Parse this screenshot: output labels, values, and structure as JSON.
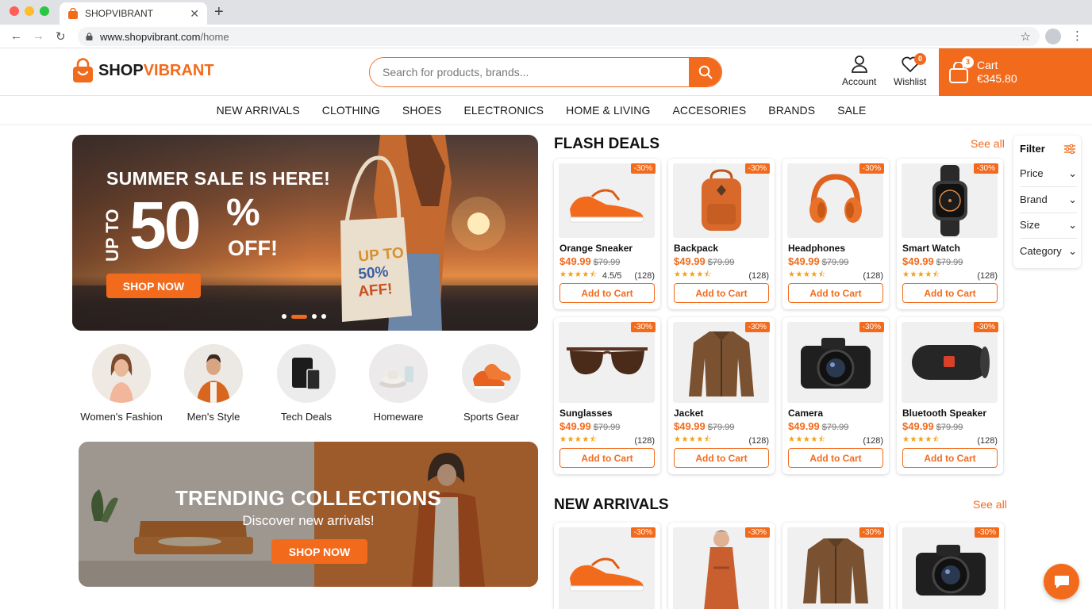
{
  "browser": {
    "tab_title": "SHOPVIBRANT",
    "url_host": "www.shopvibrant.com",
    "url_path": "/home"
  },
  "header": {
    "logo_part1": "SHOP",
    "logo_part2": "VIBRANT",
    "search_placeholder": "Search for products, brands...",
    "account_label": "Account",
    "wishlist_label": "Wishlist",
    "wishlist_count": "0",
    "cart_label": "Cart",
    "cart_total": "€345.80",
    "cart_count": "3"
  },
  "nav": [
    "NEW ARRIVALS",
    "CLOTHING",
    "SHOES",
    "ELECTRONICS",
    "HOME & LIVING",
    "ACCESORIES",
    "BRANDS",
    "SALE"
  ],
  "hero": {
    "headline": "SUMMER SALE IS HERE!",
    "upto": "UP TO",
    "big": "50",
    "pct": "%",
    "off": "OFF!",
    "button": "SHOP NOW",
    "bag_text": "UP TO 50% AFF!",
    "slides": 4,
    "active_slide": 2
  },
  "categories": [
    {
      "label": "Women's Fashion",
      "icon": "woman-icon"
    },
    {
      "label": "Men's Style",
      "icon": "man-icon"
    },
    {
      "label": "Tech Deals",
      "icon": "tablet-icon"
    },
    {
      "label": "Homeware",
      "icon": "dishes-icon"
    },
    {
      "label": "Sports Gear",
      "icon": "sneakers-icon"
    }
  ],
  "trending": {
    "title": "TRENDING COLLECTIONS",
    "subtitle": "Discover new arrivals!",
    "button": "SHOP NOW"
  },
  "flash_deals": {
    "title": "FLASH DEALS",
    "see_all": "See all",
    "products": [
      {
        "name": "Orange Sneaker",
        "price": "$49.99",
        "old_price": "$79.99",
        "discount": "-30%",
        "rating_text": "4.5/5",
        "reviews": "(128)",
        "stars": 4.5,
        "button": "Add to Cart",
        "icon": "sneaker"
      },
      {
        "name": "Backpack",
        "price": "$49.99",
        "old_price": "$79.99",
        "discount": "-30%",
        "rating_text": "",
        "reviews": "(128)",
        "stars": 4.5,
        "button": "Add to Cart",
        "icon": "backpack"
      },
      {
        "name": "Headphones",
        "price": "$49.99",
        "old_price": "$79.99",
        "discount": "-30%",
        "rating_text": "",
        "reviews": "(128)",
        "stars": 4.5,
        "button": "Add to Cart",
        "icon": "headphones"
      },
      {
        "name": "Smart Watch",
        "price": "$49.99",
        "old_price": "$79.99",
        "discount": "-30%",
        "rating_text": "",
        "reviews": "(128)",
        "stars": 4.5,
        "button": "Add to Cart",
        "icon": "watch"
      },
      {
        "name": "Sunglasses",
        "price": "$49.99",
        "old_price": "$79.99",
        "discount": "-30%",
        "rating_text": "",
        "reviews": "(128)",
        "stars": 4.5,
        "button": "Add to Cart",
        "icon": "sunglasses"
      },
      {
        "name": "Jacket",
        "price": "$49.99",
        "old_price": "$79.99",
        "discount": "-30%",
        "rating_text": "",
        "reviews": "(128)",
        "stars": 4.5,
        "button": "Add to Cart",
        "icon": "jacket"
      },
      {
        "name": "Camera",
        "price": "$49.99",
        "old_price": "$79.99",
        "discount": "-30%",
        "rating_text": "",
        "reviews": "(128)",
        "stars": 4.5,
        "button": "Add to Cart",
        "icon": "camera"
      },
      {
        "name": "Bluetooth Speaker",
        "price": "$49.99",
        "old_price": "$79.99",
        "discount": "-30%",
        "rating_text": "",
        "reviews": "(128)",
        "stars": 4.5,
        "button": "Add to Cart",
        "icon": "speaker"
      }
    ]
  },
  "new_arrivals": {
    "title": "NEW ARRIVALS",
    "see_all": "See all",
    "products": [
      {
        "discount": "-30%",
        "icon": "sneaker"
      },
      {
        "discount": "-30%",
        "icon": "dress"
      },
      {
        "discount": "-30%",
        "icon": "jacket"
      },
      {
        "discount": "-30%",
        "icon": "camera"
      }
    ]
  },
  "filter": {
    "title": "Filter",
    "items": [
      "Price",
      "Brand",
      "Size",
      "Category"
    ]
  },
  "colors": {
    "accent": "#f26b1d",
    "star": "#f2a019"
  }
}
